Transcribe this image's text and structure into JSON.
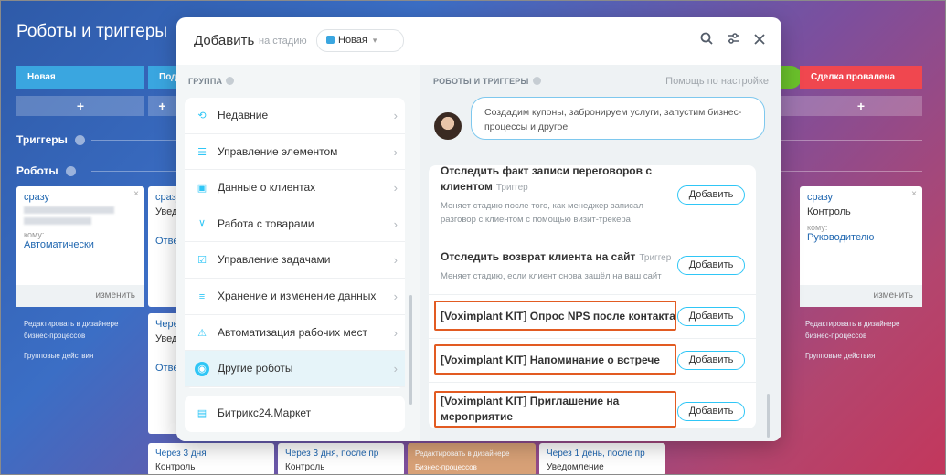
{
  "background": {
    "title": "Роботы и триггеры",
    "stages": {
      "new": "Новая",
      "second": "Под",
      "lost": "Сделка провалена"
    },
    "plus": "+",
    "triggers_label": "Триггеры",
    "robots_label": "Роботы",
    "card1": {
      "time": "сразу",
      "to_label": "кому:",
      "to_value": "Автоматически",
      "edit": "изменить"
    },
    "card2": {
      "time": "сразу",
      "title": "Увед",
      "to_value": "Отве"
    },
    "card3": {
      "time": "Через",
      "title": "Увед",
      "to_value": "Отве"
    },
    "card_right": {
      "time": "сразу",
      "title": "Контроль",
      "to_label": "кому:",
      "to_value": "Руководителю",
      "edit": "изменить"
    },
    "designer_link": "Редактировать в дизайнере бизнес-процессов",
    "group_actions": "Групповые действия",
    "bottom_cards": [
      {
        "time": "Через 3 дня",
        "title": "Контроль"
      },
      {
        "time": "Через 3 дня, после пр",
        "title": "Контроль"
      },
      {
        "time": "Редактировать в дизайнере",
        "title": "Бизнес-процессов"
      },
      {
        "time": "Через 1 день, после пр",
        "title": "Уведомление"
      }
    ]
  },
  "modal": {
    "title": "Добавить",
    "subtitle": "на стадию",
    "stage_value": "Новая",
    "icons": [
      "search-icon",
      "settings-icon",
      "close-icon"
    ],
    "left_header": "ГРУППА",
    "right_header": "РОБОТЫ И ТРИГГЕРЫ",
    "help_link": "Помощь по настройке",
    "groups": [
      {
        "label": "Недавние",
        "icon": "recent-icon"
      },
      {
        "label": "Управление элементом",
        "icon": "element-icon"
      },
      {
        "label": "Данные о клиентах",
        "icon": "client-data-icon"
      },
      {
        "label": "Работа с товарами",
        "icon": "cart-icon"
      },
      {
        "label": "Управление задачами",
        "icon": "tasks-icon"
      },
      {
        "label": "Хранение и изменение данных",
        "icon": "data-icon"
      },
      {
        "label": "Автоматизация рабочих мест",
        "icon": "automation-icon"
      },
      {
        "label": "Другие роботы",
        "icon": "robot-icon"
      }
    ],
    "market": {
      "label": "Битрикс24.Маркет",
      "icon": "market-icon"
    },
    "bubble": "Создадим купоны, забронируем услуги, запустим бизнес-процессы и другое",
    "robots": [
      {
        "name": "Отследить факт записи переговоров с клиентом",
        "tag": "Триггер",
        "desc": "Меняет стадию после того, как менеджер записал разговор с клиентом с помощью визит-трекера",
        "add": "Добавить"
      },
      {
        "name": "Отследить возврат клиента на сайт",
        "tag": "Триггер",
        "desc": "Меняет стадию, если клиент снова зашёл на ваш сайт",
        "add": "Добавить"
      },
      {
        "name": "[Voximplant KIT] Опрос NPS после контакта",
        "add": "Добавить"
      },
      {
        "name": "[Voximplant KIT] Напоминание о встрече",
        "add": "Добавить"
      },
      {
        "name": "[Voximplant KIT] Приглашение на мероприятие",
        "add": "Добавить"
      }
    ],
    "highlight_color": "#e25b22"
  }
}
